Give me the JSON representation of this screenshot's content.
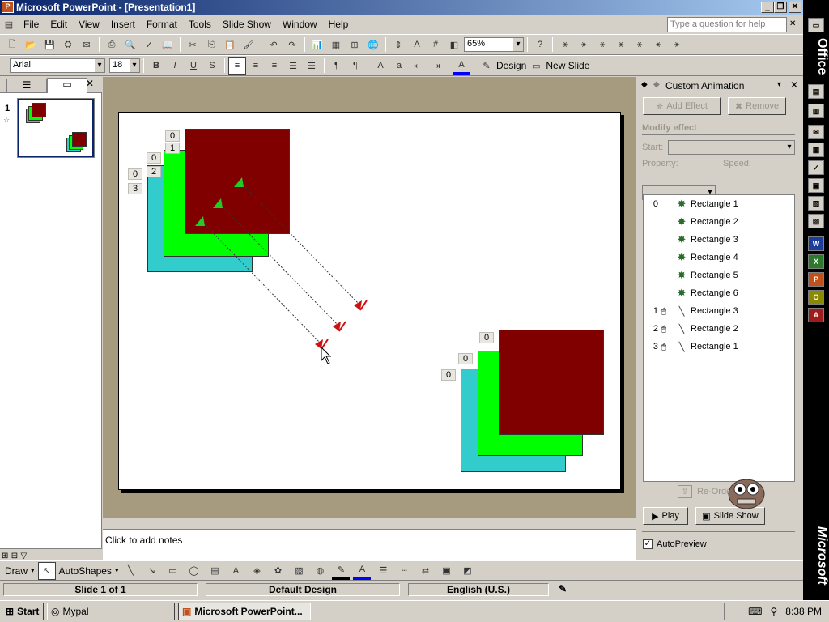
{
  "window": {
    "title": "Microsoft PowerPoint - [Presentation1]",
    "app_icon": "P"
  },
  "menu": [
    "File",
    "Edit",
    "View",
    "Insert",
    "Format",
    "Tools",
    "Slide Show",
    "Window",
    "Help"
  ],
  "help_placeholder": "Type a question for help",
  "toolbar": {
    "zoom": "65%"
  },
  "format_toolbar": {
    "font": "Arial",
    "size": "18",
    "design_label": "Design",
    "new_slide_label": "New Slide"
  },
  "slides_panel": {
    "slide_number": "1"
  },
  "slide": {
    "tags_left": [
      "0",
      "1",
      "0",
      "2",
      "0",
      "3"
    ],
    "tags_right": [
      "0",
      "0",
      "0"
    ]
  },
  "notes": {
    "placeholder": "Click to add notes"
  },
  "task_pane": {
    "title": "Custom Animation",
    "add_effect": "Add Effect",
    "remove": "Remove",
    "modify_effect": "Modify effect",
    "start_label": "Start:",
    "property_label": "Property:",
    "speed_label": "Speed:",
    "animations": [
      {
        "num": "0",
        "mouse": false,
        "kind": "star",
        "name": "Rectangle 1"
      },
      {
        "num": "",
        "mouse": false,
        "kind": "star",
        "name": "Rectangle 2"
      },
      {
        "num": "",
        "mouse": false,
        "kind": "star",
        "name": "Rectangle 3"
      },
      {
        "num": "",
        "mouse": false,
        "kind": "star",
        "name": "Rectangle 4"
      },
      {
        "num": "",
        "mouse": false,
        "kind": "star",
        "name": "Rectangle 5"
      },
      {
        "num": "",
        "mouse": false,
        "kind": "star",
        "name": "Rectangle 6"
      },
      {
        "num": "1",
        "mouse": true,
        "kind": "path",
        "name": "Rectangle 3"
      },
      {
        "num": "2",
        "mouse": true,
        "kind": "path",
        "name": "Rectangle 2"
      },
      {
        "num": "3",
        "mouse": true,
        "kind": "path",
        "name": "Rectangle 1"
      }
    ],
    "reorder": "Re-Order",
    "play": "Play",
    "slide_show": "Slide Show",
    "autopreview": "AutoPreview"
  },
  "drawbar": {
    "draw": "Draw",
    "autoshapes": "AutoShapes"
  },
  "status": {
    "slide": "Slide 1 of 1",
    "design": "Default Design",
    "language": "English (U.S.)"
  },
  "taskbar": {
    "start": "Start",
    "item1": "Mypal",
    "item2": "Microsoft PowerPoint...",
    "time": "8:38 PM"
  },
  "office_bar": {
    "top": "Office",
    "bottom": "Microsoft"
  },
  "colors": {
    "dark_red": "#800000",
    "green": "#00ff00",
    "cyan": "#33cccc",
    "title_blue": "#0a246a"
  }
}
